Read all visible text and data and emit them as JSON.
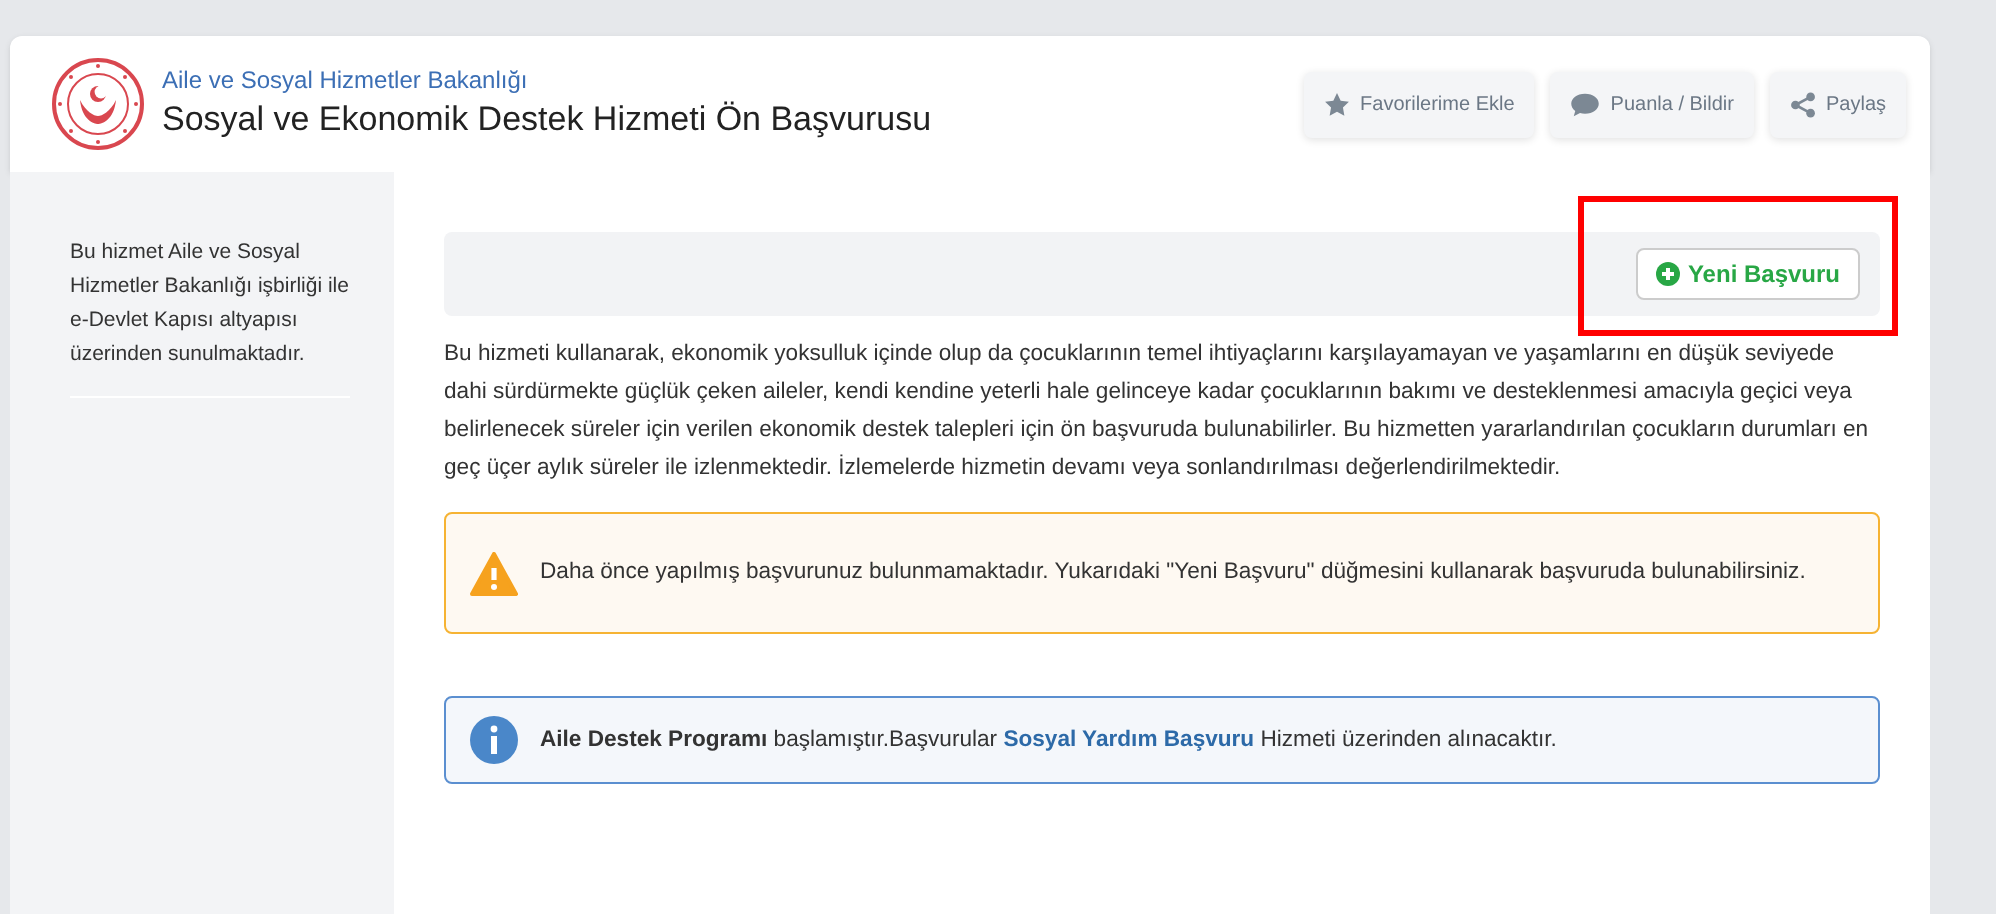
{
  "header": {
    "ministry": "Aile ve Sosyal Hizmetler Bakanlığı",
    "title": "Sosyal ve Ekonomik Destek Hizmeti Ön Başvurusu",
    "actions": [
      {
        "kind": "star",
        "label": "Favorilerime Ekle"
      },
      {
        "kind": "comment",
        "label": "Puanla / Bildir"
      },
      {
        "kind": "share",
        "label": "Paylaş"
      }
    ]
  },
  "sidebar": {
    "text": "Bu hizmet Aile ve Sosyal Hizmetler Bakanlığı işbirliği ile e-Devlet Kapısı altyapısı üzerinden sunulmaktadır."
  },
  "toolbar": {
    "new_button": {
      "label": "Yeni Başvuru",
      "highlighted": true
    }
  },
  "description": "Bu hizmeti kullanarak, ekonomik yoksulluk içinde olup da çocuklarının temel ihtiyaçlarını karşılayamayan ve yaşamlarını en düşük seviyede dahi sürdürmekte güçlük çeken aileler, kendi kendine yeterli hale gelinceye kadar çocuklarının bakımı ve desteklenmesi amacıyla geçici veya belirlenecek süreler için verilen ekonomik destek talepleri için ön başvuruda bulunabilirler. Bu hizmetten yararlandırılan çocukların durumları en geç üçer aylık süreler ile izlenmektedir. İzlemelerde hizmetin devamı veya sonlandırılması değerlendirilmektedir.",
  "alerts": [
    {
      "kind": "warning",
      "parts": [
        {
          "kind": "text",
          "text": "Daha önce yapılmış başvurunuz bulunmamaktadır. Yukarıdaki \"Yeni Başvuru\" düğmesini kullanarak başvuruda bulunabilirsiniz."
        }
      ]
    },
    {
      "kind": "info",
      "parts": [
        {
          "kind": "text",
          "text": "**Aile Destek Programı** başlamıştır.Başvurular "
        },
        {
          "kind": "link",
          "text": "Sosyal Yardım Başvuru"
        },
        {
          "kind": "text",
          "text": " Hizmeti üzerinden alınacaktır."
        }
      ]
    }
  ]
}
